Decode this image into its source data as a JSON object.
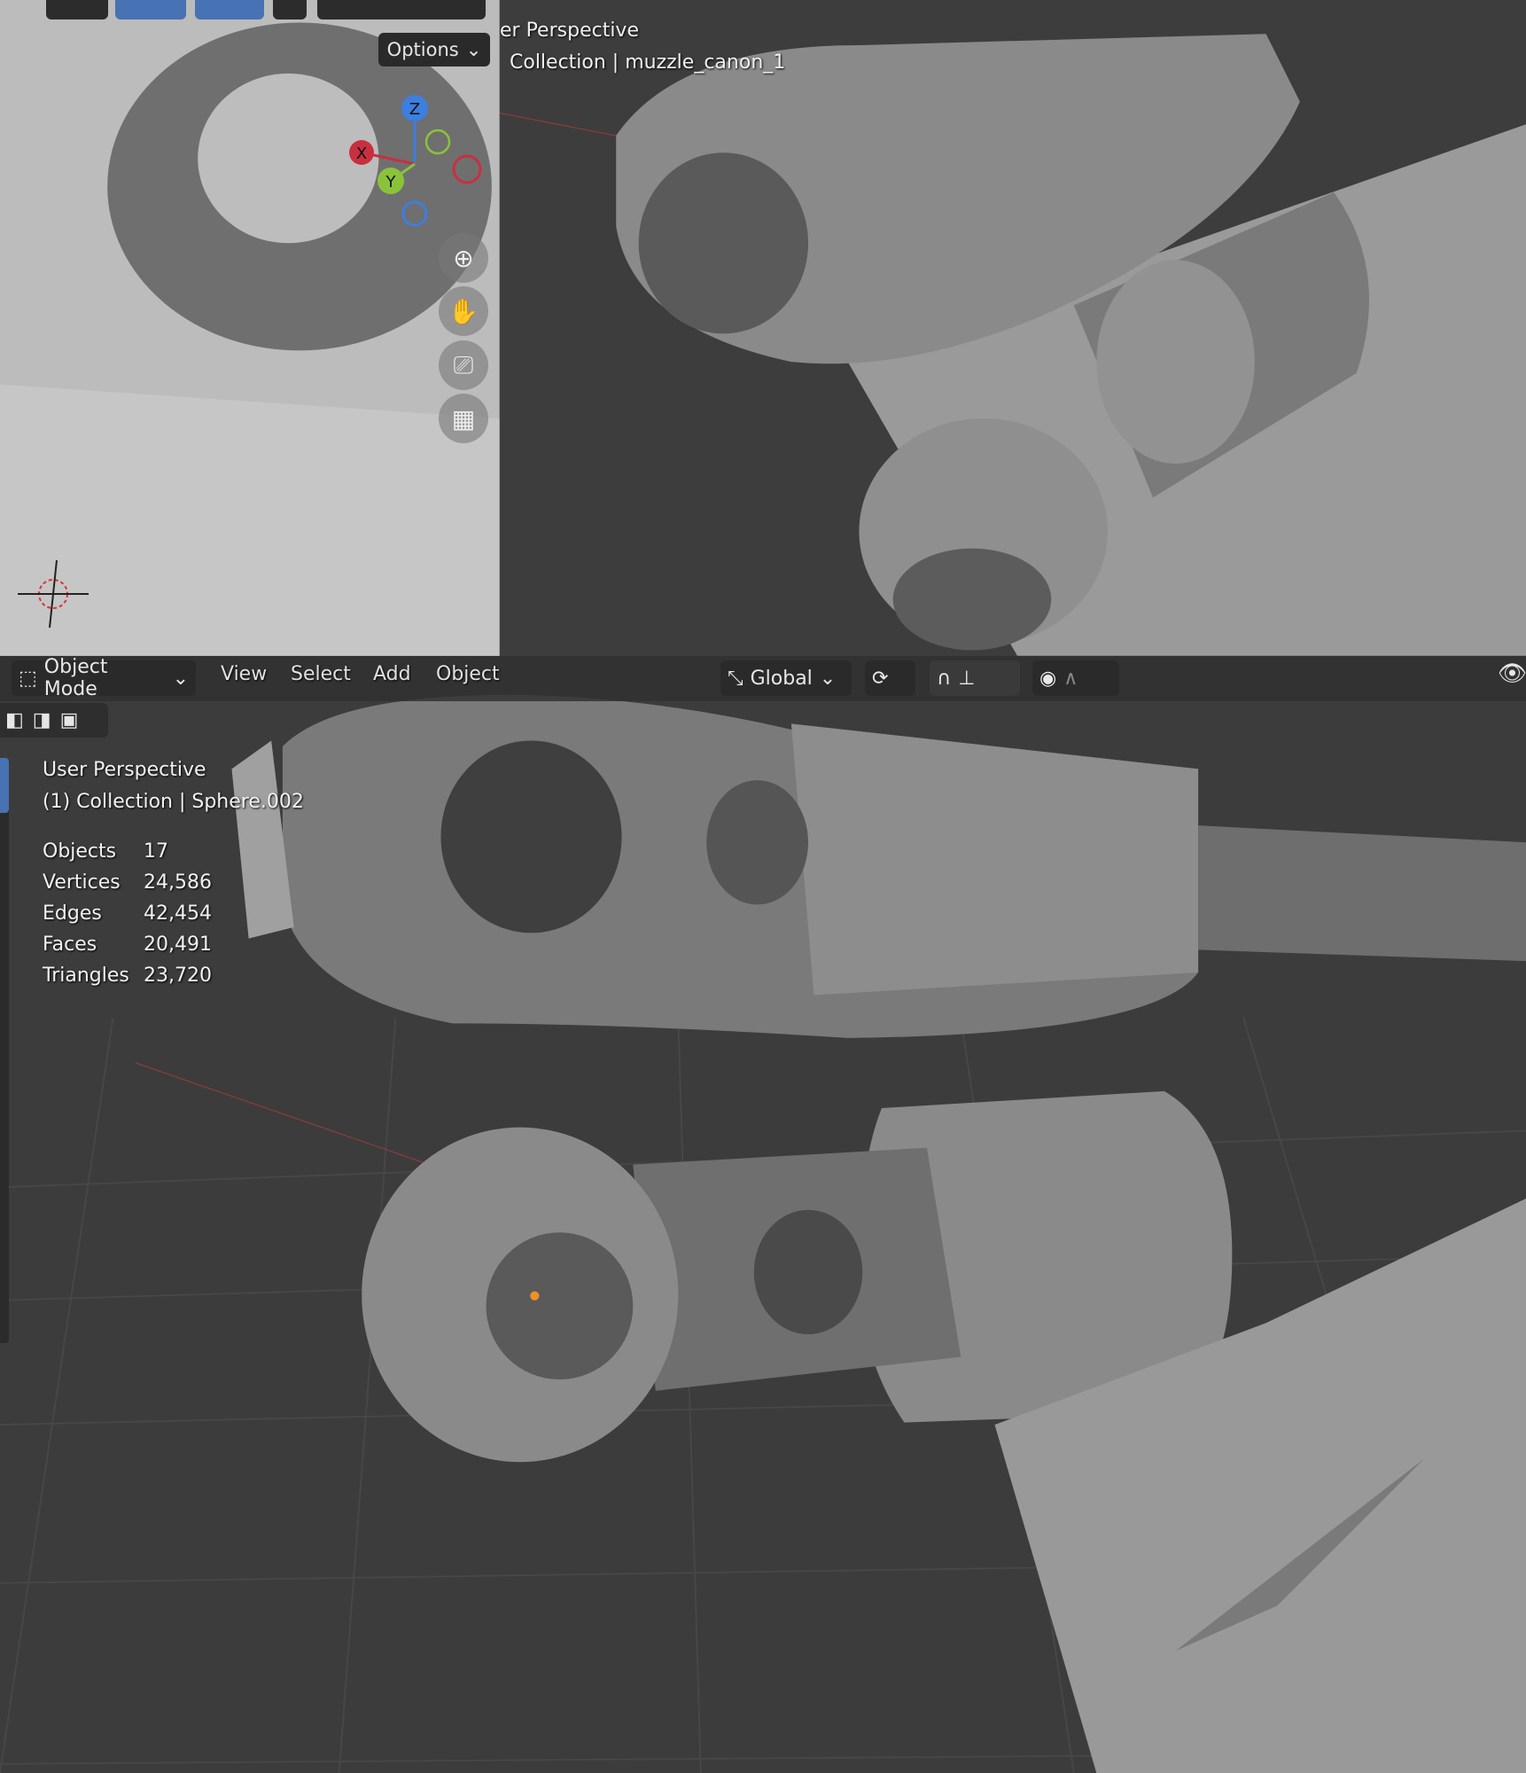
{
  "top_right_viewport": {
    "view_name": "er Perspective",
    "collection": "Collection | muzzle_canon_1"
  },
  "top_left_viewport": {
    "options_label": "Options",
    "gizmo": {
      "z": "Z",
      "x": "X",
      "y": "Y"
    }
  },
  "header": {
    "mode": "Object Mode",
    "menus": [
      "View",
      "Select",
      "Add",
      "Object"
    ],
    "orientation": "Global"
  },
  "main_viewport": {
    "view_name": "User Perspective",
    "collection": "(1) Collection | Sphere.002",
    "stats": [
      {
        "label": "Objects",
        "value": "17"
      },
      {
        "label": "Vertices",
        "value": "24,586"
      },
      {
        "label": "Edges",
        "value": "42,454"
      },
      {
        "label": "Faces",
        "value": "20,491"
      },
      {
        "label": "Triangles",
        "value": "23,720"
      }
    ]
  },
  "colors": {
    "accent": "#4772b3",
    "x_axis": "#c8303f",
    "y_axis": "#8ac33a",
    "z_axis": "#3d7ee0"
  }
}
